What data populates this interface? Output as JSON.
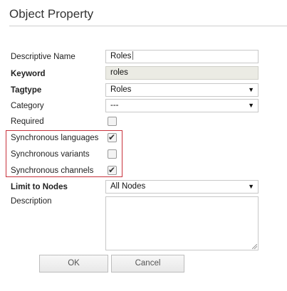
{
  "dialog": {
    "title": "Object Property"
  },
  "fields": {
    "descriptive_name": {
      "label": "Descriptive Name",
      "value": "Roles"
    },
    "keyword": {
      "label": "Keyword",
      "value": "roles"
    },
    "tagtype": {
      "label": "Tagtype",
      "value": "Roles"
    },
    "category": {
      "label": "Category",
      "value": "---"
    },
    "required": {
      "label": "Required",
      "checked": false
    },
    "sync_languages": {
      "label": "Synchronous languages",
      "checked": true
    },
    "sync_variants": {
      "label": "Synchronous variants",
      "checked": false
    },
    "sync_channels": {
      "label": "Synchronous channels",
      "checked": true
    },
    "limit_to_nodes": {
      "label": "Limit to Nodes",
      "value": "All Nodes"
    },
    "description": {
      "label": "Description",
      "value": ""
    }
  },
  "icons": {
    "dropdown": "▼",
    "check": "✔"
  },
  "buttons": {
    "ok": "OK",
    "cancel": "Cancel"
  },
  "colors": {
    "highlight_border": "#c8323c",
    "readonly_bg": "#ebebe4"
  }
}
